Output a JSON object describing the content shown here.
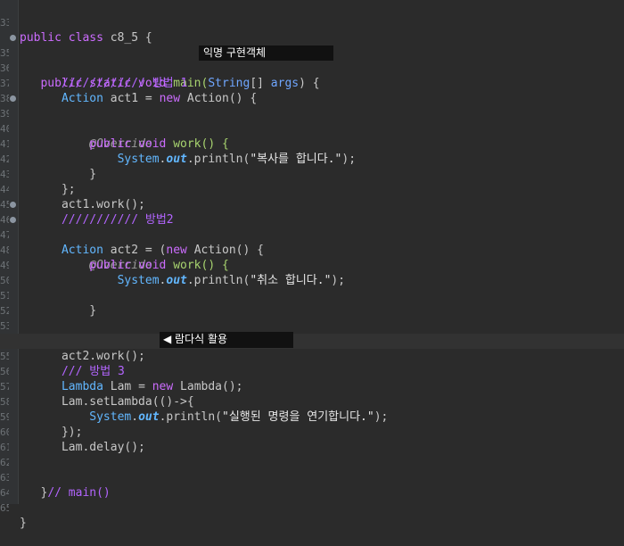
{
  "line_numbers": [
    "33",
    "35",
    "36",
    "37",
    "38",
    "39",
    "40",
    "41",
    "42",
    "43",
    "44",
    "45",
    "46",
    "47",
    "48",
    "49",
    "50",
    "51",
    "52",
    "53",
    "54",
    "55",
    "56",
    "57",
    "58",
    "59",
    "60",
    "61",
    "62",
    "63",
    "64",
    "65"
  ],
  "code": {
    "l33_a": "public class",
    "l33_b": " c8_5 {",
    "l35_a": "public static void",
    "l35_b": " main(",
    "l35_c": "String",
    "l35_d": "[] ",
    "l35_e": "args",
    "l35_f": ") {",
    "l36_a": "//////////// ",
    "l36_b": "방법 1",
    "l37_a": "Action",
    "l37_b": " act1 = ",
    "l37_c": "new",
    "l37_d": " Action() {",
    "l39": "@Override",
    "l40_a": "public void",
    "l40_b": " work() {",
    "l41_a": "System",
    "l41_b": ".",
    "l41_c": "out",
    "l41_d": ".println(",
    "l41_e": "\"복사를 합니다.\"",
    "l41_f": ");",
    "l42": "}",
    "l43": "};",
    "l44": "act1.work();",
    "l45_a": "/////////// ",
    "l45_b": "방법2",
    "l46_a": "Action",
    "l46_b": " act2 = (",
    "l46_c": "new",
    "l46_d": " Action() {",
    "l47": "@Override",
    "l48_a": "public void",
    "l48_b": " work() {",
    "l49_a": "System",
    "l49_b": ".",
    "l49_c": "out",
    "l49_d": ".println(",
    "l49_e": "\"취소 합니다.\"",
    "l49_f": ");",
    "l51": "}",
    "l53": "});",
    "l54": "act2.work();",
    "l55_a": "/// ",
    "l55_b": "방법 3",
    "l56_a": "Lambda",
    "l56_b": " Lam = ",
    "l56_c": "new",
    "l56_d": " Lambda();",
    "l57": "Lam.setLambda(()->{",
    "l58_a": "System",
    "l58_b": ".",
    "l58_c": "out",
    "l58_d": ".println(",
    "l58_e": "\"실행된 명령을 연기합니다.\"",
    "l58_f": ");",
    "l59": "});",
    "l60": "Lam.delay();",
    "l63_a": "}",
    "l63_b": "// main()",
    "l65": "}"
  },
  "annotations": {
    "method1": "익명 구현객체",
    "method3": "◀ 람다식 활용"
  }
}
